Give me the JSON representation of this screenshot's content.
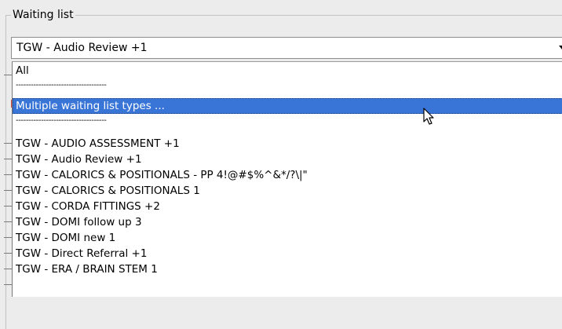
{
  "group": {
    "title": "Waiting list"
  },
  "combo": {
    "value": "TGW - Audio Review +1"
  },
  "dropdown": {
    "options": [
      "All",
      "------------------------------------",
      "Multiple waiting list types ...",
      "------------------------------------",
      "TGW - AUDIO ASSESSMENT +1",
      "TGW - Audio Review +1",
      "TGW - CALORICS & POSITIONALS - PP 4!@#$%^&*/?\\|\"",
      "TGW - CALORICS & POSITIONALS 1",
      "TGW - CORDA FITTINGS +2",
      "TGW - DOMI follow up 3",
      "TGW - DOMI new 1",
      "TGW - Direct Referral +1",
      "TGW - ERA / BRAIN STEM 1"
    ],
    "selected_index": 2
  },
  "colors": {
    "selection": "#3875d7",
    "background": "#ececec"
  },
  "icons": {
    "dropdown_arrow": "chevron-down-icon",
    "cursor": "mouse-pointer-icon"
  }
}
